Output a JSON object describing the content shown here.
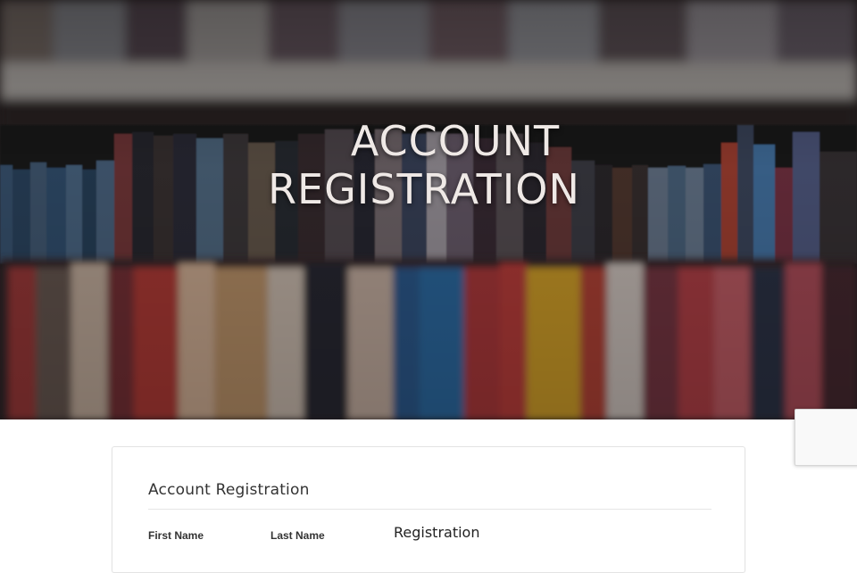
{
  "hero": {
    "title_line1": "ACCOUNT",
    "title_line2": "REGISTRATION",
    "background": "library-bookshelf-photo"
  },
  "form": {
    "title": "Account Registration",
    "fields": {
      "first_name_label": "First Name",
      "last_name_label": "Last Name"
    },
    "section_heading": "Registration"
  },
  "colors": {
    "hero_text": "#efe9e6",
    "card_border": "#e3e3e3",
    "text": "#333333"
  }
}
